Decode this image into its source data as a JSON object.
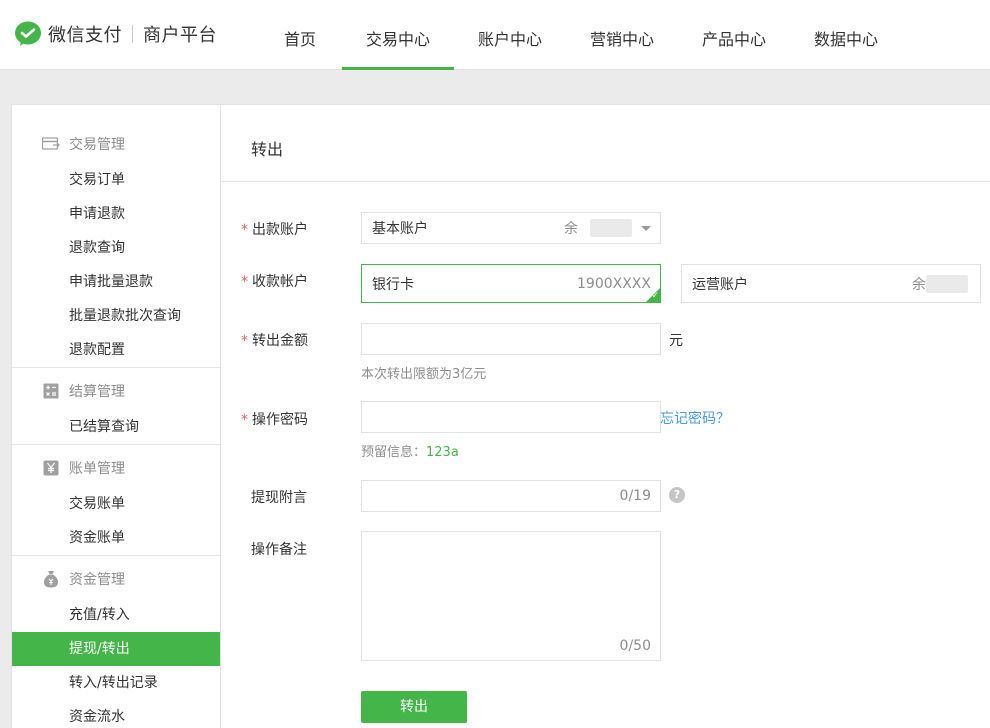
{
  "header": {
    "brand": "微信支付",
    "sub_brand": "商户平台",
    "nav": [
      {
        "label": "首页"
      },
      {
        "label": "交易中心"
      },
      {
        "label": "账户中心"
      },
      {
        "label": "营销中心"
      },
      {
        "label": "产品中心"
      },
      {
        "label": "数据中心"
      }
    ],
    "active_nav": "交易中心",
    "accent_color": "#44b549"
  },
  "sidebar": {
    "groups": [
      {
        "title": "交易管理",
        "icon": "transaction-icon",
        "items": [
          "交易订单",
          "申请退款",
          "退款查询",
          "申请批量退款",
          "批量退款批次查询",
          "退款配置"
        ]
      },
      {
        "title": "结算管理",
        "icon": "calculator-icon",
        "items": [
          "已结算查询"
        ]
      },
      {
        "title": "账单管理",
        "icon": "yen-icon",
        "items": [
          "交易账单",
          "资金账单"
        ]
      },
      {
        "title": "资金管理",
        "icon": "money-bag-icon",
        "items": [
          "充值/转入",
          "提现/转出",
          "转入/转出记录",
          "资金流水"
        ]
      }
    ],
    "active_item": "提现/转出"
  },
  "main": {
    "title": "转出",
    "form": {
      "from_account": {
        "label": "出款账户",
        "value": "基本账户",
        "balance_prefix": "余"
      },
      "to_account": {
        "label": "收款帐户",
        "option1": {
          "value": "银行卡",
          "number": "1900XXXX"
        },
        "option2": {
          "value": "运营账户",
          "balance_prefix": "余"
        }
      },
      "amount": {
        "label": "转出金额",
        "value": "",
        "unit": "元",
        "hint": "本次转出限额为3亿元"
      },
      "password": {
        "label": "操作密码",
        "value": "",
        "forgot_link": "忘记密码？",
        "hint_prefix": "预留信息：",
        "hint_value": "123a"
      },
      "message": {
        "label": "提现附言",
        "value": "",
        "counter": "0/19"
      },
      "remark": {
        "label": "操作备注",
        "value": "",
        "counter": "0/50"
      },
      "submit_label": "转出"
    }
  }
}
